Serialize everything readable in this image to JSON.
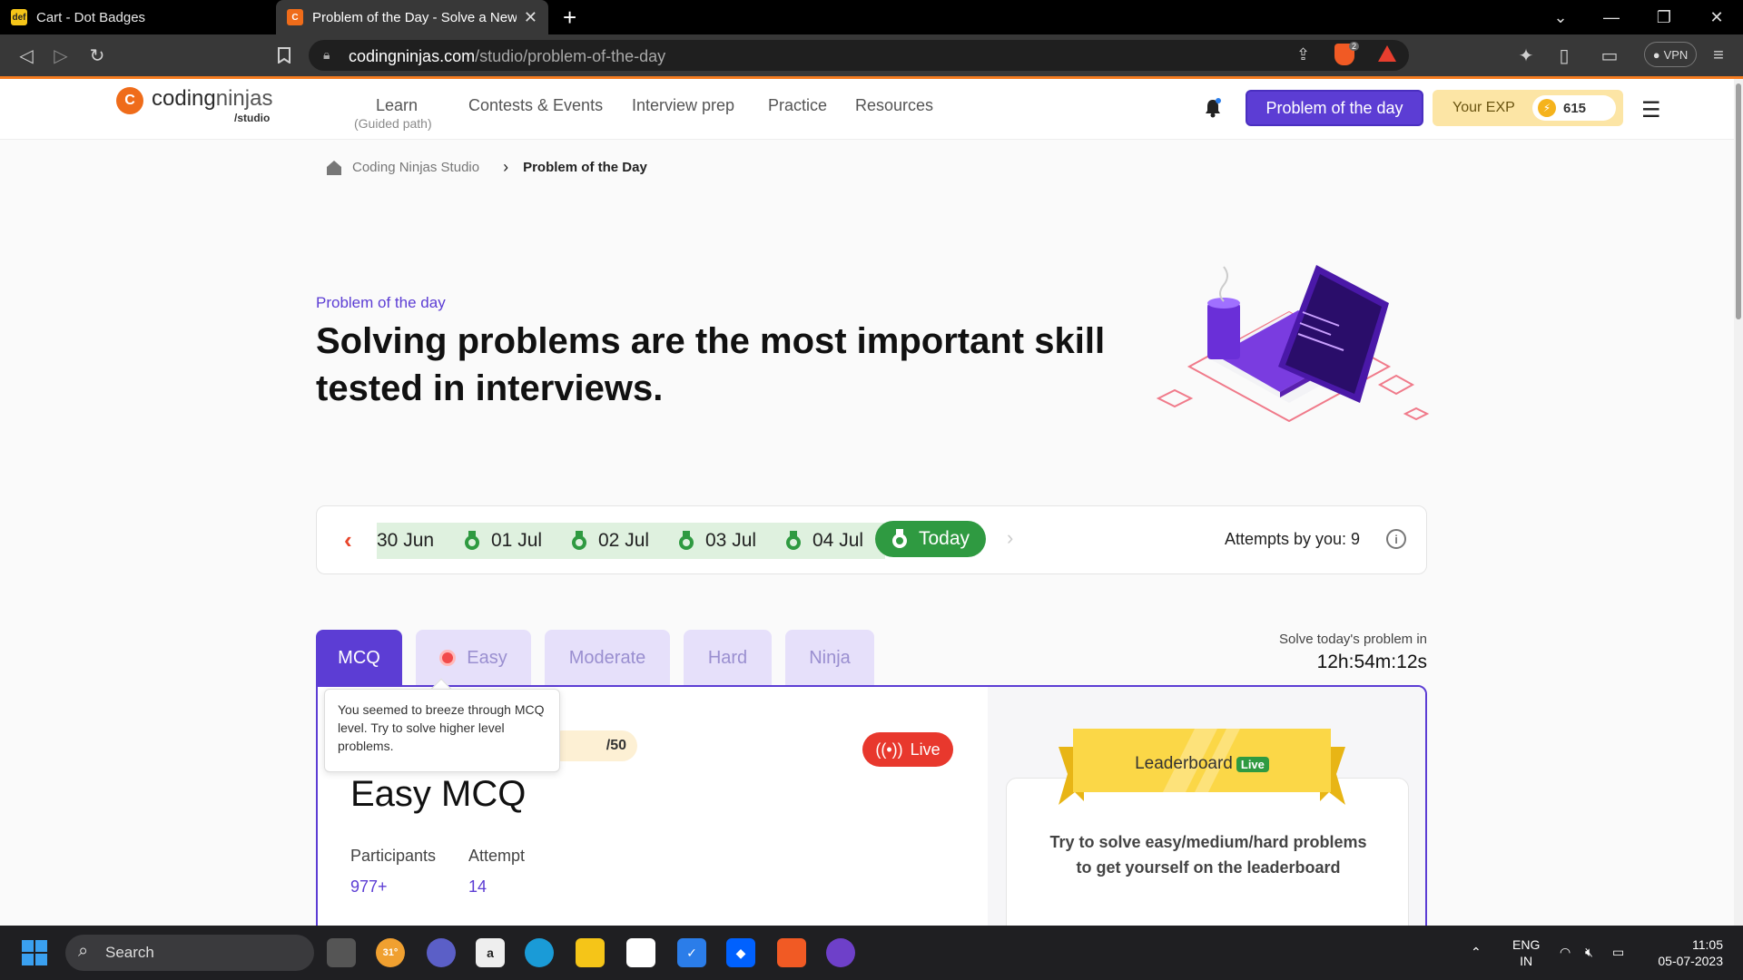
{
  "browser": {
    "tabs": [
      {
        "title": "Cart - Dot Badges",
        "active": false
      },
      {
        "title": "Problem of the Day - Solve a New",
        "active": true
      }
    ],
    "url_host": "codingninjas.com",
    "url_path": "/studio/problem-of-the-day",
    "brave_badge": "2",
    "vpn_label": "VPN"
  },
  "header": {
    "logo_main": "coding",
    "logo_main2": "ninjas",
    "logo_sub": "/studio",
    "nav": [
      {
        "label": "Learn",
        "sub": "(Guided path)"
      },
      {
        "label": "Contests & Events"
      },
      {
        "label": "Interview prep"
      },
      {
        "label": "Practice"
      },
      {
        "label": "Resources"
      }
    ],
    "potd_button": "Problem of the day",
    "exp_label": "Your EXP",
    "exp_value": "615"
  },
  "breadcrumb": {
    "home": "Coding Ninjas Studio",
    "current": "Problem of the Day"
  },
  "hero": {
    "kicker": "Problem of the day",
    "title": "Solving problems are the most important skill tested in interviews."
  },
  "dates": {
    "items": [
      "30 Jun",
      "01 Jul",
      "02 Jul",
      "03 Jul",
      "04 Jul"
    ],
    "today": "Today",
    "attempts_label": "Attempts by you: 9"
  },
  "levels": {
    "tabs": [
      "MCQ",
      "Easy",
      "Moderate",
      "Hard",
      "Ninja"
    ],
    "timer_label": "Solve today's problem in",
    "timer_value": "12h:54m:12s"
  },
  "tooltip": {
    "text": "You seemed to breeze through MCQ level. Try to solve higher level problems."
  },
  "card": {
    "score": "/50",
    "live_label": "Live",
    "title": "Easy MCQ",
    "participants_label": "Participants",
    "participants_value": "977+",
    "attempt_label": "Attempt",
    "attempt_value": "14"
  },
  "leaderboard": {
    "title": "Leaderboard",
    "badge": "Live",
    "text_line1": "Try to solve easy/medium/hard problems",
    "text_line2": "to get yourself on the leaderboard"
  },
  "taskbar": {
    "search": "Search",
    "weather": "31°",
    "lang1": "ENG",
    "lang2": "IN",
    "time": "11:05",
    "date": "05-07-2023"
  },
  "colors": {
    "brand_purple": "#5c3dd4",
    "brand_orange": "#ef6c1a",
    "success_green": "#2f9a41",
    "live_red": "#e8382d"
  }
}
